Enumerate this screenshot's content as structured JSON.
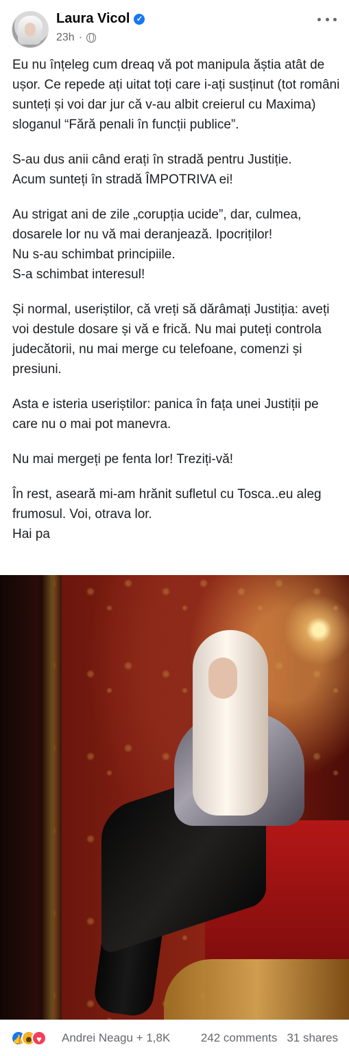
{
  "header": {
    "author": "Laura Vicol",
    "time": "23h",
    "separator": "·",
    "icons": [
      "verified-badge-icon",
      "globe-icon",
      "more-icon"
    ],
    "accent_color": "#1877f2"
  },
  "post": {
    "paragraphs": [
      "Eu nu înțeleg cum dreaq vă pot manipula ăștia atât de ușor. Ce repede ați uitat toți care i-ați susținut (tot români sunteți și voi dar jur că v-au albit creierul cu Maxima) sloganul “Fără penali în funcții publice”.",
      "S-au dus anii când erați în stradă pentru Justiție.\nAcum sunteți în stradă ÎMPOTRIVA ei!",
      "Au strigat ani de zile „corupția ucide”, dar, culmea, dosarele lor nu vă mai deranjează. Ipocriților!\nNu s-au schimbat principiile.\nS-a schimbat interesul!",
      "Și normal, useriștilor, că vreți să dărâmați Justiția: aveți voi destule dosare și vă e frică. Nu mai puteți controla judecătorii, nu mai merge cu telefoane, comenzi și presiuni.",
      "Asta e isteria useriștilor: panica în fața unei Justiții pe care nu o mai pot manevra.",
      "Nu mai mergeți pe fenta lor! Treziți-vă!",
      "În rest, aseară mi-am hrănit sufletul cu Tosca..eu aleg frumosul. Voi, otrava lor.\nHai pa"
    ]
  },
  "footer": {
    "reaction_icons": [
      "like-icon",
      "haha-icon",
      "love-icon"
    ],
    "reaction_text": "Andrei Neagu + 1,8K",
    "comments": "242 comments",
    "shares": "31 shares"
  }
}
